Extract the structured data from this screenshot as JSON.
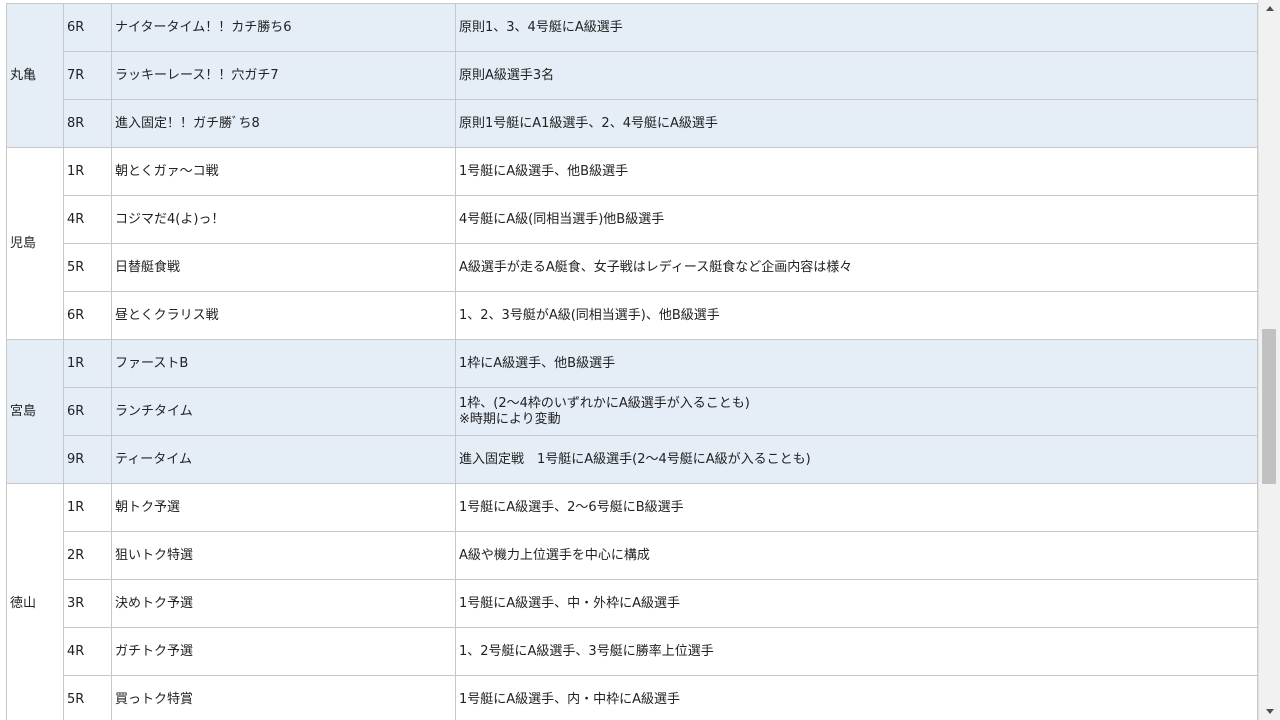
{
  "colors": {
    "shaded_row": "#e5edf7",
    "border": "#c8c8c8",
    "scrollbar_thumb": "#c1c1c1"
  },
  "scroll": {
    "position_fraction": 0.5
  },
  "groups": [
    {
      "venue": "丸亀",
      "shaded": true,
      "races": [
        {
          "no": "6R",
          "name": "ナイタータイム！！カチ勝ち6",
          "desc": "原則1、3、4号艇にA級選手"
        },
        {
          "no": "7R",
          "name": "ラッキーレース！！穴ガチ7",
          "desc": "原則A級選手3名"
        },
        {
          "no": "8R",
          "name": "進入固定！！ガチ勝ﾞち8",
          "desc": "原則1号艇にA1級選手、2、4号艇にA級選手"
        }
      ]
    },
    {
      "venue": "児島",
      "shaded": false,
      "races": [
        {
          "no": "1R",
          "name": "朝とくガァ～コ戦",
          "desc": "1号艇にA級選手、他B級選手"
        },
        {
          "no": "4R",
          "name": "コジマだ4(よ)っ！",
          "desc": "4号艇にA級(同相当選手)他B級選手"
        },
        {
          "no": "5R",
          "name": "日替艇食戦",
          "desc": "A級選手が走るA艇食、女子戦はレディース艇食など企画内容は様々"
        },
        {
          "no": "6R",
          "name": "昼とくクラリス戦",
          "desc": "1、2、3号艇がA級(同相当選手)、他B級選手"
        }
      ]
    },
    {
      "venue": "宮島",
      "shaded": true,
      "races": [
        {
          "no": "1R",
          "name": "ファーストB",
          "desc": "1枠にA級選手、他B級選手"
        },
        {
          "no": "6R",
          "name": "ランチタイム",
          "desc": "1枠、(2～4枠のいずれかにA級選手が入ることも)",
          "note": "※時期により変動"
        },
        {
          "no": "9R",
          "name": "ティータイム",
          "desc": "進入固定戦　1号艇にA級選手(2～4号艇にA級が入ることも)"
        }
      ]
    },
    {
      "venue": "徳山",
      "shaded": false,
      "races": [
        {
          "no": "1R",
          "name": "朝トク予選",
          "desc": "1号艇にA級選手、2～6号艇にB級選手"
        },
        {
          "no": "2R",
          "name": "狙いトク特選",
          "desc": "A級や機力上位選手を中心に構成"
        },
        {
          "no": "3R",
          "name": "決めトク予選",
          "desc": "1号艇にA級選手、中・外枠にA級選手"
        },
        {
          "no": "4R",
          "name": "ガチトク予選",
          "desc": "1、2号艇にA級選手、3号艇に勝率上位選手"
        },
        {
          "no": "5R",
          "name": "買っトク特賞",
          "desc": "1号艇にA級選手、内・中枠にA級選手"
        }
      ]
    }
  ]
}
